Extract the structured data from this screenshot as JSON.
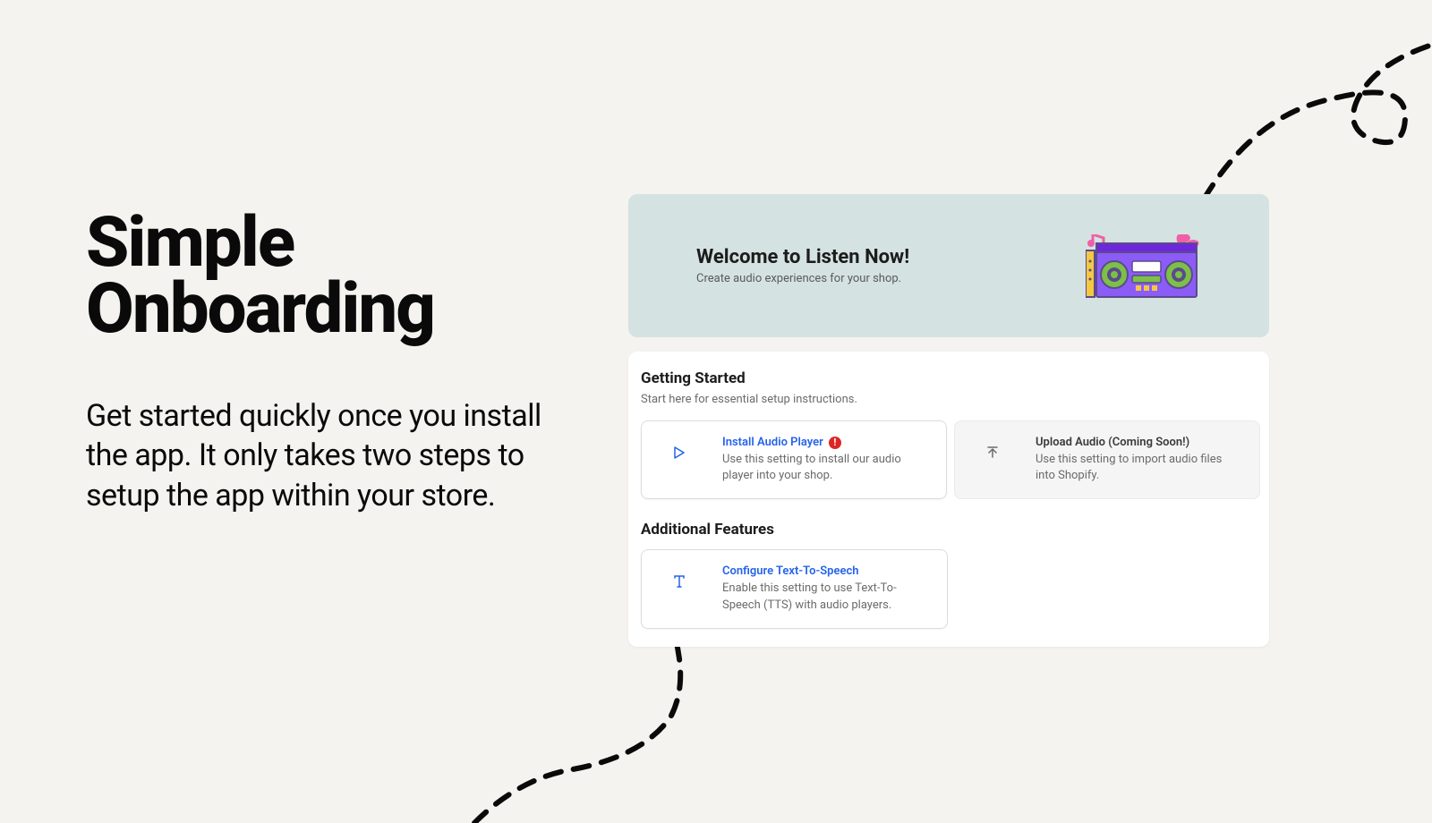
{
  "hero": {
    "title_line1": "Simple",
    "title_line2": "Onboarding",
    "subtitle": "Get started quickly once you install the app. It only takes two steps to setup the app within your store."
  },
  "welcome": {
    "title": "Welcome to Listen Now!",
    "subtitle": "Create audio experiences for your shop."
  },
  "sections": {
    "getting_started": {
      "title": "Getting Started",
      "subtitle": "Start here for essential setup instructions.",
      "cards": [
        {
          "title": "Install Audio Player",
          "description": "Use this setting to install our audio player into your shop.",
          "icon": "play",
          "has_alert": true,
          "enabled": true
        },
        {
          "title": "Upload Audio (Coming Soon!)",
          "description": "Use this setting to import audio files into Shopify.",
          "icon": "upload",
          "has_alert": false,
          "enabled": false
        }
      ]
    },
    "additional_features": {
      "title": "Additional Features",
      "cards": [
        {
          "title": "Configure Text-To-Speech",
          "description": "Enable this setting to use Text-To-Speech (TTS) with audio players.",
          "icon": "text",
          "has_alert": false,
          "enabled": true
        }
      ]
    }
  }
}
